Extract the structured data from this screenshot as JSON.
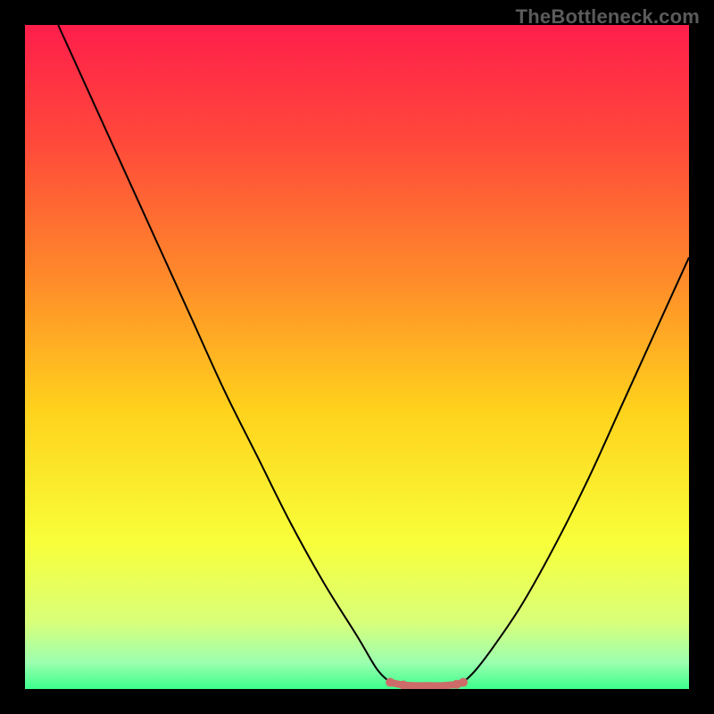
{
  "watermark": "TheBottleneck.com",
  "colors": {
    "frame_bg": "#000000",
    "curve": "#000000",
    "marker": "#cd6b69",
    "gradient_stops": [
      {
        "pos": 0.0,
        "color": "#ff1e4b"
      },
      {
        "pos": 0.18,
        "color": "#ff4a3a"
      },
      {
        "pos": 0.38,
        "color": "#ff8a2a"
      },
      {
        "pos": 0.58,
        "color": "#ffd21c"
      },
      {
        "pos": 0.78,
        "color": "#f8ff3a"
      },
      {
        "pos": 0.9,
        "color": "#d8ff7a"
      },
      {
        "pos": 0.96,
        "color": "#9cffb0"
      },
      {
        "pos": 1.0,
        "color": "#3cff8c"
      }
    ]
  },
  "chart_data": {
    "type": "line",
    "title": "",
    "xlabel": "",
    "ylabel": "",
    "xlim": [
      0,
      100
    ],
    "ylim": [
      0,
      100
    ],
    "series": [
      {
        "name": "left-curve",
        "x": [
          5,
          10,
          15,
          20,
          25,
          30,
          35,
          40,
          45,
          50,
          53,
          55
        ],
        "y": [
          100,
          89,
          78,
          67,
          56,
          45,
          35,
          25,
          16,
          8,
          3,
          1
        ]
      },
      {
        "name": "right-curve",
        "x": [
          66,
          68,
          71,
          75,
          80,
          85,
          90,
          95,
          100
        ],
        "y": [
          1,
          3,
          7,
          13,
          22,
          32,
          43,
          54,
          65
        ]
      },
      {
        "name": "bottom-flat",
        "x": [
          55,
          57,
          59,
          61,
          63,
          65,
          66
        ],
        "y": [
          1,
          0.6,
          0.5,
          0.5,
          0.5,
          0.7,
          1
        ]
      }
    ],
    "highlight_marker": {
      "series": "bottom-flat",
      "color": "#cd6b69"
    }
  }
}
